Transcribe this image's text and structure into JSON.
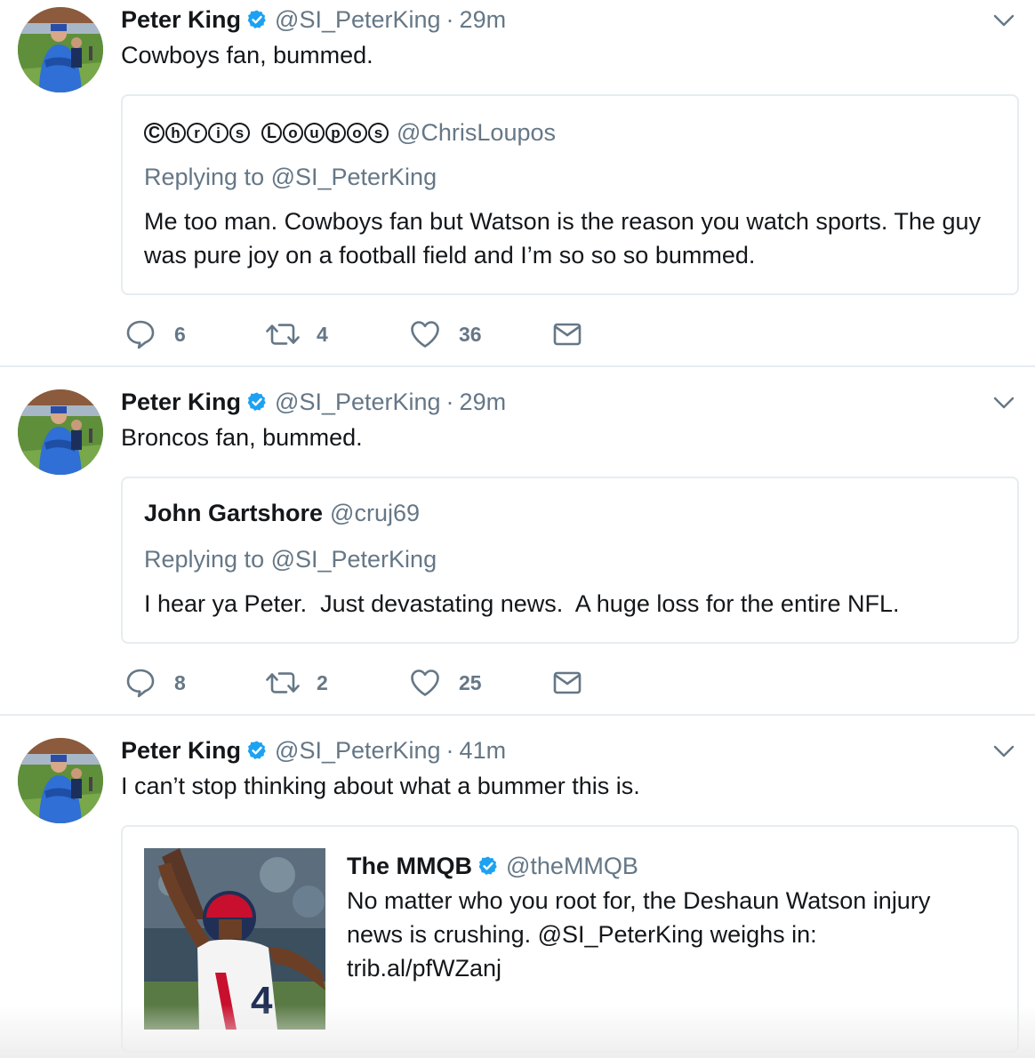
{
  "colors": {
    "primary_text": "#14171a",
    "secondary_text": "#657786",
    "verified_blue": "#1da1f2",
    "divider": "#e6ecf0"
  },
  "tweets": [
    {
      "author_name": "Peter King",
      "author_handle": "@SI_PeterKing",
      "separator": "·",
      "time": "29m",
      "text": "Cowboys fan, bummed.",
      "quote": {
        "name": "Ⓒⓗⓡⓘⓢ Ⓛⓞⓤⓟⓞⓢ",
        "handle": "@ChrisLoupos",
        "replying_to": "Replying to @SI_PeterKing",
        "text": "Me too man. Cowboys fan but Watson is the reason you watch sports. The guy was pure joy on a football field and I’m so so so bummed."
      },
      "stats": {
        "replies": "6",
        "retweets": "4",
        "likes": "36"
      }
    },
    {
      "author_name": "Peter King",
      "author_handle": "@SI_PeterKing",
      "separator": "·",
      "time": "29m",
      "text": "Broncos fan, bummed.",
      "quote": {
        "name": "John Gartshore",
        "handle": "@cruj69",
        "replying_to": "Replying to @SI_PeterKing",
        "text": "I hear ya Peter.  Just devastating news.  A huge loss for the entire NFL."
      },
      "stats": {
        "replies": "8",
        "retweets": "2",
        "likes": "25"
      }
    },
    {
      "author_name": "Peter King",
      "author_handle": "@SI_PeterKing",
      "separator": "·",
      "time": "41m",
      "text": "I can’t stop thinking about what a bummer this is.",
      "quote": {
        "name": "The MMQB",
        "handle": "@theMMQB",
        "text_line1": "No matter who you root for, the Deshaun Watson injury",
        "text_line2": "news is crushing. @SI_PeterKing weighs in:",
        "text_line3": "trib.al/pfWZanj"
      }
    }
  ],
  "icons": {
    "reply": "reply-icon",
    "retweet": "retweet-icon",
    "like": "heart-icon",
    "dm": "envelope-icon",
    "caret": "chevron-down-icon",
    "verified": "verified-badge-icon"
  }
}
